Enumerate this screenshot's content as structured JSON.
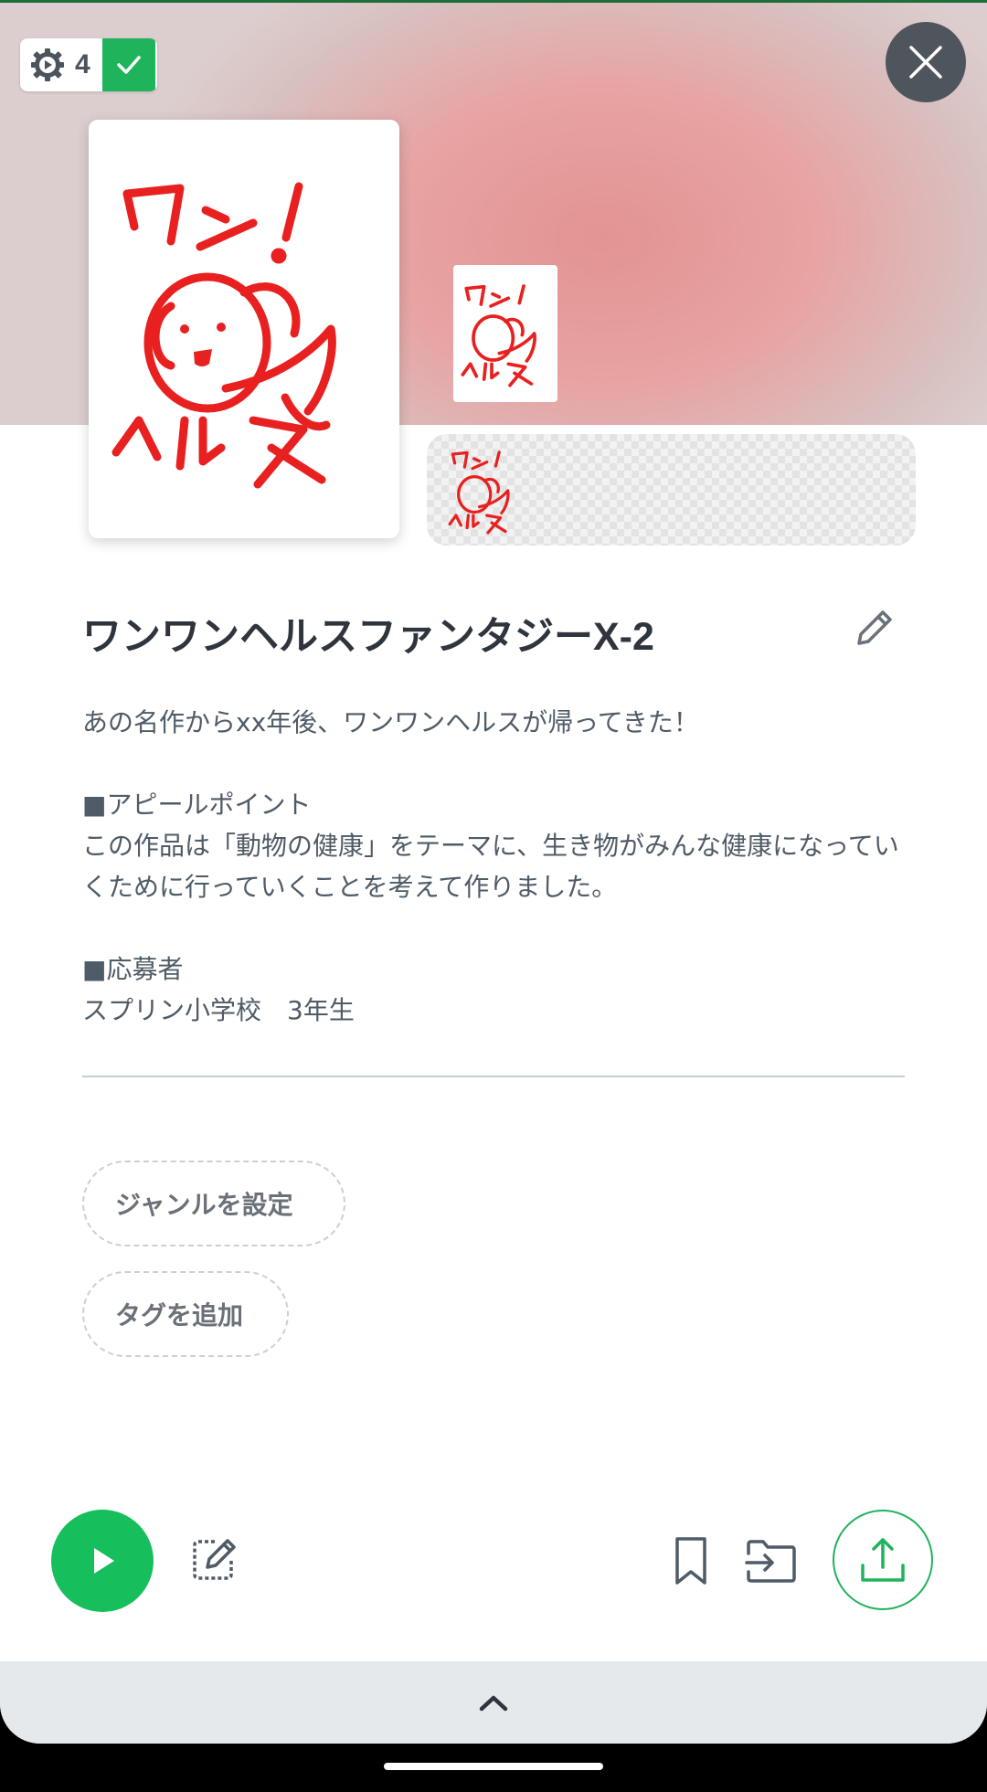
{
  "header": {
    "build_count": "4",
    "close_label": "close"
  },
  "artwork": {
    "text_top": "ワン！",
    "text_bottom": "ヘルス"
  },
  "app": {
    "title": "ワンワンヘルスファンタジーX-2",
    "description": "あの名作からxx年後、ワンワンヘルスが帰ってきた！\n\n■アピールポイント\nこの作品は「動物の健康」をテーマに、生き物がみんな健康になっていくために行っていくことを考えて作りました。\n\n■応募者\nスプリン小学校　3年生"
  },
  "chips": {
    "genre_label": "ジャンルを設定",
    "tag_label": "タグを追加"
  },
  "toolbar": {
    "play_icon": "play-icon",
    "edit_icon": "edit-code-icon",
    "bookmark_icon": "bookmark-icon",
    "folder_icon": "move-to-folder-icon",
    "share_icon": "upload-share-icon"
  },
  "colors": {
    "accent_green": "#16bf5b",
    "drawing_red": "#e8201f",
    "close_bg": "#4f555c",
    "hero_pink": "#e39393"
  }
}
